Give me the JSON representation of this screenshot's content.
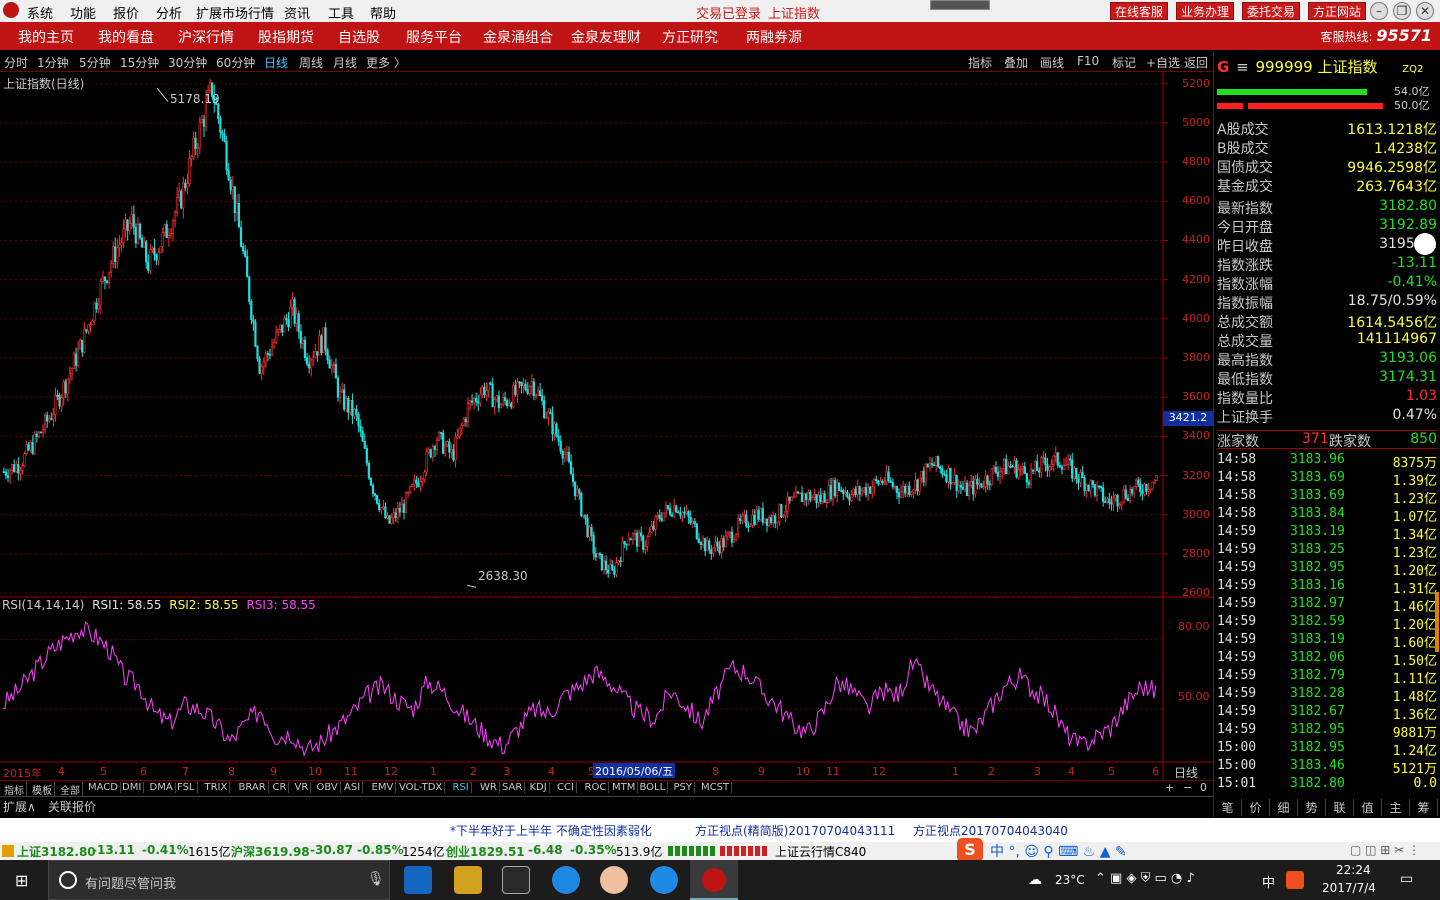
{
  "menubar": {
    "items": [
      "系统",
      "功能",
      "报价",
      "分析",
      "扩展市场行情",
      "资讯",
      "工具",
      "帮助"
    ],
    "status_login": "交易已登录",
    "status_index": "上证指数",
    "buttons": [
      "在线客服",
      "业务办理",
      "委托交易",
      "方正网站"
    ]
  },
  "navbar": {
    "items": [
      "我的主页",
      "我的看盘",
      "沪深行情",
      "股指期货",
      "自选股",
      "服务平台",
      "金泉涌组合",
      "金泉友理财",
      "方正研究",
      "两融券源"
    ],
    "hotline_label": "客服热线:",
    "hotline_number": "95571"
  },
  "periodbar": {
    "periods": [
      "分时",
      "1分钟",
      "5分钟",
      "15分钟",
      "30分钟",
      "60分钟",
      "日线",
      "周线",
      "月线",
      "更多 〉"
    ],
    "active": "日线",
    "tools": [
      "指标",
      "叠加",
      "画线",
      "F10",
      "标记",
      "+自选",
      "返回"
    ]
  },
  "chart": {
    "title": "上证指数(日线)",
    "y_ticks": [
      "5200",
      "5000",
      "4800",
      "4600",
      "4400",
      "4200",
      "4000",
      "3800",
      "3600",
      "3400",
      "3200",
      "3000",
      "2800",
      "2600"
    ],
    "high_label": "5178.19",
    "low_label": "2638.30",
    "cursor_price": "3421.2",
    "rsi_header": {
      "name": "RSI(14,14,14)",
      "rsi1": "RSI1: 58.55",
      "rsi2": "RSI2: 58.55",
      "rsi3": "RSI3: 58.55"
    },
    "rsi_ticks": [
      "80.00",
      "50.00"
    ],
    "x_labels": [
      "2015年",
      "4",
      "5",
      "6",
      "7",
      "8",
      "9",
      "10",
      "11",
      "12",
      "1",
      "2",
      "3",
      "4",
      "5",
      "7",
      "8",
      "9",
      "10",
      "11",
      "12",
      "1",
      "2",
      "3",
      "4",
      "5",
      "6",
      "7"
    ],
    "cursor_date": "2016/05/06/五",
    "period_label": "日线"
  },
  "chart_data": {
    "type": "candlestick",
    "title": "上证指数(日线)",
    "ylim": [
      2580,
      5260
    ],
    "y_ticks": [
      2600,
      2800,
      3000,
      3200,
      3400,
      3600,
      3800,
      4000,
      4200,
      4400,
      4600,
      4800,
      5000,
      5200
    ],
    "annotations": [
      {
        "label": "5178.19",
        "value": 5178.19
      },
      {
        "label": "2638.30",
        "value": 2638.3
      }
    ],
    "close_path": [
      3220,
      3260,
      3380,
      3520,
      3700,
      3900,
      4150,
      4350,
      4500,
      4280,
      4420,
      4600,
      4900,
      5178,
      4800,
      4300,
      3750,
      3900,
      4050,
      3800,
      3900,
      3600,
      3500,
      3150,
      2950,
      3050,
      3200,
      3400,
      3300,
      3550,
      3650,
      3560,
      3620,
      3680,
      3500,
      3320,
      3050,
      2780,
      2700,
      2900,
      2850,
      3000,
      3050,
      2950,
      2820,
      2860,
      2950,
      3000,
      2980,
      3050,
      3100,
      3080,
      3150,
      3100,
      3140,
      3180,
      3120,
      3160,
      3260,
      3210,
      3120,
      3160,
      3230,
      3250,
      3200,
      3260,
      3280,
      3200,
      3140,
      3060,
      3110,
      3140,
      3180
    ],
    "rsi": {
      "name": "RSI(14,14,14)",
      "series": [
        {
          "name": "RSI1",
          "last": 58.55
        },
        {
          "name": "RSI2",
          "last": 58.55
        },
        {
          "name": "RSI3",
          "last": 58.55
        }
      ],
      "ylim": [
        28,
        92
      ],
      "ticks": [
        80,
        50
      ],
      "path": [
        52,
        58,
        66,
        74,
        80,
        85,
        82,
        76,
        64,
        60,
        48,
        44,
        52,
        50,
        44,
        36,
        44,
        50,
        38,
        40,
        32,
        36,
        42,
        48,
        56,
        60,
        54,
        50,
        62,
        58,
        50,
        44,
        38,
        34,
        42,
        50,
        48,
        56,
        60,
        66,
        62,
        54,
        48,
        46,
        58,
        52,
        44,
        56,
        68,
        66,
        58,
        52,
        44,
        40,
        48,
        62,
        58,
        50,
        58,
        56,
        70,
        60,
        52,
        44,
        40,
        50,
        60,
        64,
        58,
        52,
        40,
        34,
        38,
        42,
        52,
        60,
        58
      ]
    }
  },
  "panel": {
    "code": "999999",
    "name": "上证指数",
    "tag": "ZQ2",
    "bar1_value": "54.0亿",
    "bar2_value": "50.0亿",
    "volume": [
      {
        "label": "A股成交",
        "value": "1613.1218亿"
      },
      {
        "label": "B股成交",
        "value": "1.4238亿"
      },
      {
        "label": "国债成交",
        "value": "9946.2598亿"
      },
      {
        "label": "基金成交",
        "value": "263.7643亿"
      }
    ],
    "stats": [
      {
        "label": "最新指数",
        "value": "3182.80",
        "color": "grn"
      },
      {
        "label": "今日开盘",
        "value": "3192.89",
        "color": "grn"
      },
      {
        "label": "昨日收盘",
        "value": "3195.91",
        "color": "wht"
      },
      {
        "label": "指数涨跌",
        "value": "-13.11",
        "color": "grn"
      },
      {
        "label": "指数涨幅",
        "value": "-0.41%",
        "color": "grn"
      },
      {
        "label": "指数振幅",
        "value": "18.75/0.59%",
        "color": "wht"
      },
      {
        "label": "总成交额",
        "value": "1614.5456亿",
        "color": "yel"
      },
      {
        "label": "总成交量",
        "value": "141114967",
        "color": "yel"
      },
      {
        "label": "最高指数",
        "value": "3193.06",
        "color": "grn"
      },
      {
        "label": "最低指数",
        "value": "3174.31",
        "color": "grn"
      },
      {
        "label": "指数量比",
        "value": "1.03",
        "color": "red"
      },
      {
        "label": "上证换手",
        "value": "0.47%",
        "color": "wht"
      }
    ],
    "up_label": "涨家数",
    "up_value": "371",
    "down_label": "跌家数",
    "down_value": "850",
    "ticks": [
      [
        "14:58",
        "3183.96",
        "8375万"
      ],
      [
        "14:58",
        "3183.69",
        "1.39亿"
      ],
      [
        "14:58",
        "3183.69",
        "1.23亿"
      ],
      [
        "14:58",
        "3183.84",
        "1.07亿"
      ],
      [
        "14:59",
        "3183.19",
        "1.34亿"
      ],
      [
        "14:59",
        "3183.25",
        "1.23亿"
      ],
      [
        "14:59",
        "3182.95",
        "1.20亿"
      ],
      [
        "14:59",
        "3183.16",
        "1.31亿"
      ],
      [
        "14:59",
        "3182.97",
        "1.46亿"
      ],
      [
        "14:59",
        "3182.59",
        "1.20亿"
      ],
      [
        "14:59",
        "3183.19",
        "1.60亿"
      ],
      [
        "14:59",
        "3182.06",
        "1.50亿"
      ],
      [
        "14:59",
        "3182.79",
        "1.11亿"
      ],
      [
        "14:59",
        "3182.28",
        "1.48亿"
      ],
      [
        "14:59",
        "3182.67",
        "1.36亿"
      ],
      [
        "14:59",
        "3182.95",
        "9881万"
      ],
      [
        "15:00",
        "3182.95",
        "1.24亿"
      ],
      [
        "15:00",
        "3183.46",
        "5121万"
      ],
      [
        "15:01",
        "3182.80",
        "0.0"
      ]
    ],
    "bottom_tabs": [
      "笔",
      "价",
      "细",
      "势",
      "联",
      "值",
      "主",
      "筹"
    ]
  },
  "indicator_tabs": [
    "指标",
    "模板",
    "全部",
    "MACD",
    "DMI",
    "DMA",
    "FSL",
    "TRIX",
    "BRAR",
    "CR",
    "VR",
    "OBV",
    "ASI",
    "EMV",
    "VOL-TDX",
    "RSI",
    "WR",
    "SAR",
    "KDJ",
    "CCI",
    "ROC",
    "MTM",
    "BOLL",
    "PSY",
    "MCST"
  ],
  "active_indicator": "RSI",
  "ext_row": [
    "扩展∧",
    "关联报价"
  ],
  "news": [
    "*下半年好于上半年 不确定性因素弱化",
    "方正视点(精简版)20170704043111",
    "方正视点20170704043040"
  ],
  "statusbar": {
    "sh": "上证3182.80",
    "sh_chg": "-13.11",
    "sh_pct": "-0.41%",
    "sh_vol": "1615亿",
    "sz": "沪深3619.98",
    "sz_chg": "-30.87",
    "sz_pct": "-0.85%",
    "sz_vol": "1254亿",
    "cy": "创业1829.51",
    "cy_chg": "-6.48",
    "cy_pct": "-0.35%",
    "cy_vol": "513.9亿",
    "cloud": "上证云行情C840"
  },
  "taskbar": {
    "search_placeholder": "有问题尽管问我",
    "temp": "23°C",
    "ime": "中",
    "time": "22:24",
    "date": "2017/7/4"
  }
}
